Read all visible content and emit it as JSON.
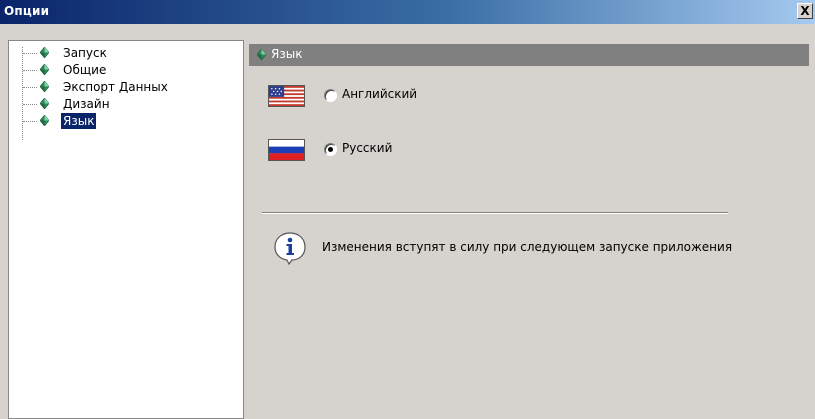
{
  "window": {
    "title": "Опции",
    "close_label": "X"
  },
  "tree": {
    "items": [
      {
        "label": "Запуск",
        "selected": false
      },
      {
        "label": "Общие",
        "selected": false
      },
      {
        "label": "Экспорт Данных",
        "selected": false
      },
      {
        "label": "Дизайн",
        "selected": false
      },
      {
        "label": "Язык",
        "selected": true
      }
    ],
    "node_icon": "green-diamond-icon"
  },
  "panel": {
    "title": "Язык",
    "languages": [
      {
        "label": "Английский",
        "flag": "us-flag-icon",
        "checked": false
      },
      {
        "label": "Русский",
        "flag": "russia-flag-icon",
        "checked": true
      }
    ],
    "info_icon": "info-icon",
    "info_text": "Изменения вступят в силу при следующем запуске приложения"
  },
  "colors": {
    "title_bar_start": "#0a246a",
    "title_bar_end": "#a6caf0",
    "dialog_bg": "#d6d3ce",
    "panel_header_bg": "#808080",
    "selection_bg": "#0a246a",
    "node_icon_green": "#2e8b57"
  }
}
